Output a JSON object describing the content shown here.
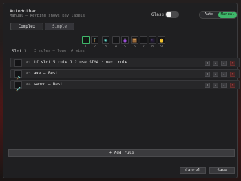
{
  "header": {
    "title": "AutoHotbar",
    "subtitle": "Manual — keybind shows key labels"
  },
  "glass": {
    "label": "Glass",
    "enabled": false
  },
  "mode": {
    "auto_label": "Auto",
    "manual_label": "Manual",
    "selected": "Manual"
  },
  "tabs": {
    "complex_label": "Complex",
    "simple_label": "Simple",
    "selected": "Complex"
  },
  "hotbar": {
    "selected_slot": 1,
    "slots": [
      {
        "number": "1",
        "icon": "empty-slot"
      },
      {
        "number": "2",
        "icon": "pickaxe-icon"
      },
      {
        "number": "3",
        "icon": "compass-icon"
      },
      {
        "number": "4",
        "icon": "empty-slot"
      },
      {
        "number": "5",
        "icon": "potion-icon"
      },
      {
        "number": "6",
        "icon": "crafting-table-icon"
      },
      {
        "number": "7",
        "icon": "empty-slot"
      },
      {
        "number": "8",
        "icon": "obsidian-icon"
      },
      {
        "number": "9",
        "icon": "golden-apple-icon"
      }
    ]
  },
  "slot_info": {
    "label": "Slot 1",
    "meta": "3 rules — lower # wins"
  },
  "rules": [
    {
      "index": "#1",
      "text": "if slot 5 rule 1 ? use SIM4 : next rule",
      "icon": "empty-slot"
    },
    {
      "index": "#3",
      "text": "axe — Best",
      "icon": "axe-icon"
    },
    {
      "index": "#4",
      "text": "sword — Best",
      "icon": "sword-icon"
    }
  ],
  "actions": {
    "move_up_label": "↑",
    "move_down_label": "↓",
    "link_label": "↔",
    "delete_label": "×"
  },
  "add_rule_label": "+ Add rule",
  "footer": {
    "cancel_label": "Cancel",
    "save_label": "Save"
  },
  "colors": {
    "accent": "#3fb76a",
    "delete": "#ff6060",
    "panel": "#1f1f21"
  }
}
